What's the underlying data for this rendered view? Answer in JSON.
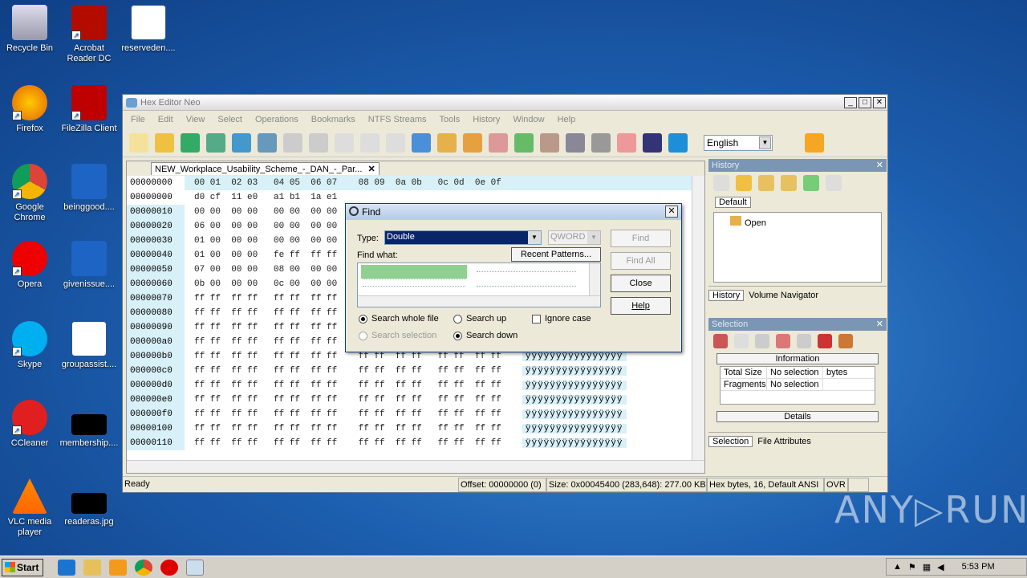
{
  "desktop": {
    "icons": [
      {
        "label": "Recycle Bin",
        "icon": "recycle-bin-icon"
      },
      {
        "label": "Acrobat Reader DC",
        "icon": "acrobat-icon"
      },
      {
        "label": "reserveden....",
        "icon": "word-doc-icon"
      },
      {
        "label": "Firefox",
        "icon": "firefox-icon"
      },
      {
        "label": "FileZilla Client",
        "icon": "filezilla-icon"
      },
      {
        "label": "Google Chrome",
        "icon": "chrome-icon"
      },
      {
        "label": "beinggood....",
        "icon": "file-icon"
      },
      {
        "label": "Opera",
        "icon": "opera-icon"
      },
      {
        "label": "givenissue....",
        "icon": "file-icon"
      },
      {
        "label": "Skype",
        "icon": "skype-icon"
      },
      {
        "label": "groupassist....",
        "icon": "word-doc-icon"
      },
      {
        "label": "CCleaner",
        "icon": "ccleaner-icon"
      },
      {
        "label": "membership....",
        "icon": "image-icon"
      },
      {
        "label": "VLC media player",
        "icon": "vlc-icon"
      },
      {
        "label": "readeras.jpg",
        "icon": "image-icon"
      }
    ]
  },
  "window": {
    "title": "Hex Editor Neo",
    "menu": [
      "File",
      "Edit",
      "View",
      "Select",
      "Operations",
      "Bookmarks",
      "NTFS Streams",
      "Tools",
      "History",
      "Window",
      "Help"
    ],
    "language": "English",
    "doc_tab": "NEW_Workplace_Usability_Scheme_-_DAN_-_Par...",
    "hex_header": {
      "offset": "00000000",
      "cols": "00 01  02 03   04 05  06 07    08 09  0a 0b   0c 0d  0e 0f"
    },
    "hex_rows": [
      {
        "off": "00000000",
        "bytes": "d0 cf  11 e0   a1 b1  1a e1",
        "asc": ""
      },
      {
        "off": "00000010",
        "bytes": "00 00  00 00   00 00  00 00",
        "asc": ""
      },
      {
        "off": "00000020",
        "bytes": "06 00  00 00   00 00  00 00",
        "asc": ""
      },
      {
        "off": "00000030",
        "bytes": "01 00  00 00   00 00  00 00",
        "asc": ""
      },
      {
        "off": "00000040",
        "bytes": "01 00  00 00   fe ff  ff ff",
        "asc": ""
      },
      {
        "off": "00000050",
        "bytes": "07 00  00 00   08 00  00 00",
        "asc": ""
      },
      {
        "off": "00000060",
        "bytes": "0b 00  00 00   0c 00  00 00",
        "asc": ""
      },
      {
        "off": "00000070",
        "bytes": "ff ff  ff ff   ff ff  ff ff",
        "asc": ""
      },
      {
        "off": "00000080",
        "bytes": "ff ff  ff ff   ff ff  ff ff",
        "asc": ""
      },
      {
        "off": "00000090",
        "bytes": "ff ff  ff ff   ff ff  ff ff",
        "asc": ""
      },
      {
        "off": "000000a0",
        "bytes": "ff ff  ff ff   ff ff  ff ff",
        "asc": ""
      },
      {
        "off": "000000b0",
        "bytes": "ff ff  ff ff   ff ff  ff ff    ff ff  ff ff   ff ff  ff ff",
        "asc": "ÿÿÿÿÿÿÿÿÿÿÿÿÿÿÿÿ"
      },
      {
        "off": "000000c0",
        "bytes": "ff ff  ff ff   ff ff  ff ff    ff ff  ff ff   ff ff  ff ff",
        "asc": "ÿÿÿÿÿÿÿÿÿÿÿÿÿÿÿÿ"
      },
      {
        "off": "000000d0",
        "bytes": "ff ff  ff ff   ff ff  ff ff    ff ff  ff ff   ff ff  ff ff",
        "asc": "ÿÿÿÿÿÿÿÿÿÿÿÿÿÿÿÿ"
      },
      {
        "off": "000000e0",
        "bytes": "ff ff  ff ff   ff ff  ff ff    ff ff  ff ff   ff ff  ff ff",
        "asc": "ÿÿÿÿÿÿÿÿÿÿÿÿÿÿÿÿ"
      },
      {
        "off": "000000f0",
        "bytes": "ff ff  ff ff   ff ff  ff ff    ff ff  ff ff   ff ff  ff ff",
        "asc": "ÿÿÿÿÿÿÿÿÿÿÿÿÿÿÿÿ"
      },
      {
        "off": "00000100",
        "bytes": "ff ff  ff ff   ff ff  ff ff    ff ff  ff ff   ff ff  ff ff",
        "asc": "ÿÿÿÿÿÿÿÿÿÿÿÿÿÿÿÿ"
      },
      {
        "off": "00000110",
        "bytes": "ff ff  ff ff   ff ff  ff ff    ff ff  ff ff   ff ff  ff ff",
        "asc": "ÿÿÿÿÿÿÿÿÿÿÿÿÿÿÿÿ"
      }
    ],
    "status": {
      "ready": "Ready",
      "offset": "Offset: 00000000 (0)",
      "size": "Size: 0x00045400 (283,648): 277.00 KB",
      "mode": "Hex bytes, 16, Default ANSI",
      "ovr": "OVR"
    },
    "history_pane": {
      "title": "History",
      "default_tab": "Default",
      "item": "Open",
      "tabs": [
        "History",
        "Volume Navigator"
      ]
    },
    "selection_pane": {
      "title": "Selection",
      "info_header": "Information",
      "rows": [
        {
          "k": "Total Size",
          "v": "No selection",
          "u": "bytes"
        },
        {
          "k": "Fragments",
          "v": "No selection",
          "u": ""
        }
      ],
      "details": "Details",
      "tabs": [
        "Selection",
        "File Attributes"
      ]
    }
  },
  "find_dialog": {
    "title": "Find",
    "type_label": "Type:",
    "type_value": "Double",
    "qword_value": "QWORD",
    "find_what_label": "Find what:",
    "recent_patterns": "Recent Patterns...",
    "buttons": {
      "find": "Find",
      "find_all": "Find All",
      "close": "Close",
      "help": "Help"
    },
    "options": {
      "search_whole_file": "Search whole file",
      "search_selection": "Search selection",
      "search_up": "Search up",
      "search_down": "Search down",
      "ignore_case": "Ignore case"
    }
  },
  "taskbar": {
    "start": "Start",
    "clock": "5:53 PM"
  },
  "watermark": "ANY▷RUN"
}
